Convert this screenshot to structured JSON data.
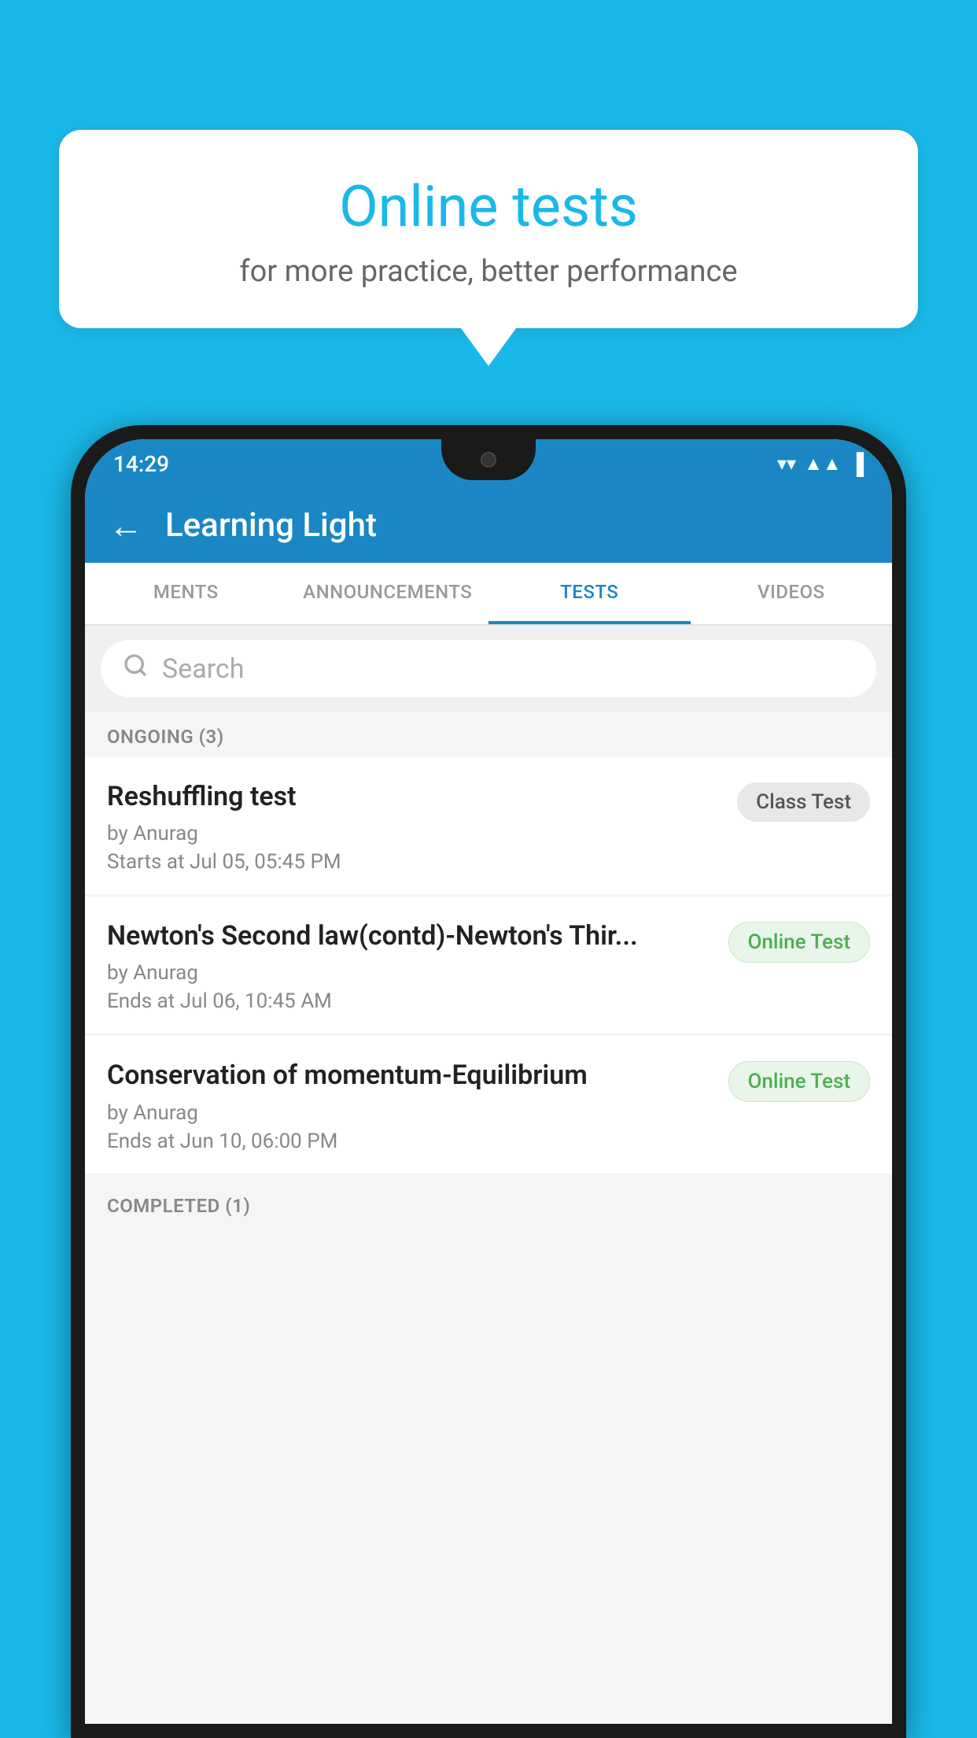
{
  "background": {
    "color": "#1ab8e8"
  },
  "speech_bubble": {
    "title": "Online tests",
    "subtitle": "for more practice, better performance"
  },
  "phone": {
    "status_bar": {
      "time": "14:29",
      "wifi_icon": "▼",
      "signal_bars": "◀",
      "battery": "▮"
    },
    "header": {
      "back_label": "←",
      "title": "Learning Light"
    },
    "tabs": [
      {
        "label": "MENTS",
        "active": false
      },
      {
        "label": "ANNOUNCEMENTS",
        "active": false
      },
      {
        "label": "TESTS",
        "active": true
      },
      {
        "label": "VIDEOS",
        "active": false
      }
    ],
    "search": {
      "placeholder": "Search"
    },
    "ongoing_section": {
      "label": "ONGOING (3)"
    },
    "test_items": [
      {
        "name": "Reshuffling test",
        "author": "by Anurag",
        "date_label": "Starts at  Jul 05, 05:45 PM",
        "badge": "Class Test",
        "badge_type": "class"
      },
      {
        "name": "Newton's Second law(contd)-Newton's Thir...",
        "author": "by Anurag",
        "date_label": "Ends at  Jul 06, 10:45 AM",
        "badge": "Online Test",
        "badge_type": "online"
      },
      {
        "name": "Conservation of momentum-Equilibrium",
        "author": "by Anurag",
        "date_label": "Ends at  Jun 10, 06:00 PM",
        "badge": "Online Test",
        "badge_type": "online"
      }
    ],
    "completed_section": {
      "label": "COMPLETED (1)"
    }
  }
}
